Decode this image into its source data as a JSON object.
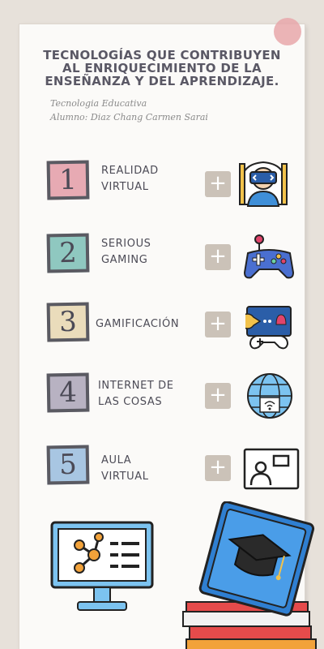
{
  "header": {
    "title": "TECNOLOGÍAS QUE CONTRIBUYEN AL ENRIQUECIMIENTO DE LA ENSEÑANZA Y DEL APRENDIZAJE.",
    "subject": "Tecnologia Educativa",
    "student": "Alumno: Diaz Chang Carmen Sarai"
  },
  "items": [
    {
      "number": "1",
      "label_line1": "REALIDAD",
      "label_line2": "VIRTUAL",
      "icon": "vr-headset-icon",
      "accent": "#e7aab3"
    },
    {
      "number": "2",
      "label_line1": "SERIOUS",
      "label_line2": "GAMING",
      "icon": "gamepad-icon",
      "accent": "#8fc8c0"
    },
    {
      "number": "3",
      "label_line1": "GAMIFICACIÓN",
      "label_line2": "",
      "icon": "arcade-game-icon",
      "accent": "#eadcbb"
    },
    {
      "number": "4",
      "label_line1": "INTERNET DE",
      "label_line2": "LAS COSAS",
      "icon": "globe-wifi-icon",
      "accent": "#b8b2c2"
    },
    {
      "number": "5",
      "label_line1": "AULA",
      "label_line2": "VIRTUAL",
      "icon": "virtual-classroom-icon",
      "accent": "#a8c6e2"
    }
  ],
  "plus_symbol": "+",
  "colors": {
    "paper": "#fbfaf8",
    "background": "#e7e1da",
    "text": "#4c4b56",
    "plus_bg": "#cbc2b8"
  }
}
